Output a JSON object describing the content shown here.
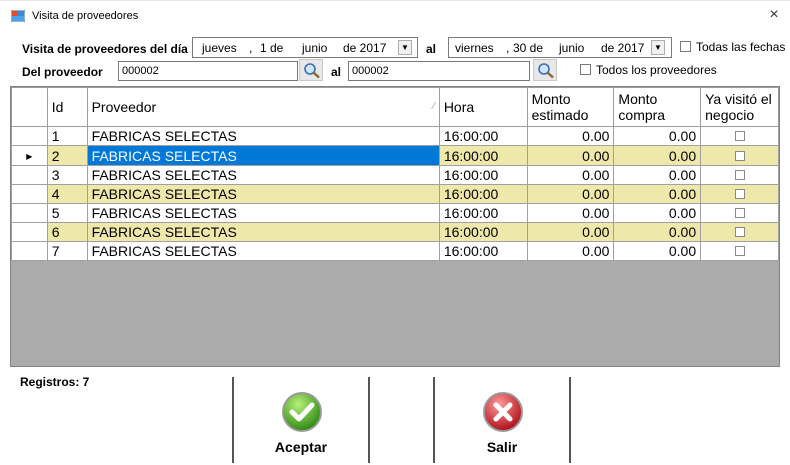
{
  "window": {
    "title": "Visita de proveedores",
    "close_label": "×"
  },
  "form": {
    "visit_label": "Visita de proveedores del día",
    "date_from": {
      "weekday": "jueves",
      "sep": ",",
      "day": "1 de",
      "month": "junio",
      "year": "de 2017"
    },
    "al_label_1": "al",
    "date_to": {
      "weekday": "viernes",
      "sep": ",",
      "day": "30 de",
      "month": "junio",
      "year": "de 2017"
    },
    "all_dates_label": "Todas las fechas",
    "supplier_label": "Del proveedor",
    "supplier_from": "000002",
    "al_label_2": "al",
    "supplier_to": "000002",
    "all_suppliers_label": "Todos los proveedores"
  },
  "grid": {
    "columns": [
      "Id",
      "Proveedor",
      "Hora",
      "Monto estimado",
      "Monto compra",
      "Ya visitó el negocio"
    ],
    "rows": [
      {
        "id": "1",
        "proveedor": "FABRICAS SELECTAS",
        "hora": "16:00:00",
        "estimado": "0.00",
        "compra": "0.00"
      },
      {
        "id": "2",
        "proveedor": "FABRICAS SELECTAS",
        "hora": "16:00:00",
        "estimado": "0.00",
        "compra": "0.00"
      },
      {
        "id": "3",
        "proveedor": "FABRICAS SELECTAS",
        "hora": "16:00:00",
        "estimado": "0.00",
        "compra": "0.00"
      },
      {
        "id": "4",
        "proveedor": "FABRICAS SELECTAS",
        "hora": "16:00:00",
        "estimado": "0.00",
        "compra": "0.00"
      },
      {
        "id": "5",
        "proveedor": "FABRICAS SELECTAS",
        "hora": "16:00:00",
        "estimado": "0.00",
        "compra": "0.00"
      },
      {
        "id": "6",
        "proveedor": "FABRICAS SELECTAS",
        "hora": "16:00:00",
        "estimado": "0.00",
        "compra": "0.00"
      },
      {
        "id": "7",
        "proveedor": "FABRICAS SELECTAS",
        "hora": "16:00:00",
        "estimado": "0.00",
        "compra": "0.00"
      }
    ],
    "selected_row": 2,
    "alt_color": "#eee8aa",
    "selection_color": "#0078d7"
  },
  "footer": {
    "records_label": "Registros: 7",
    "accept_label": "Aceptar",
    "exit_label": "Salir",
    "accept_icon": "check-circle-icon",
    "exit_icon": "x-circle-icon"
  }
}
